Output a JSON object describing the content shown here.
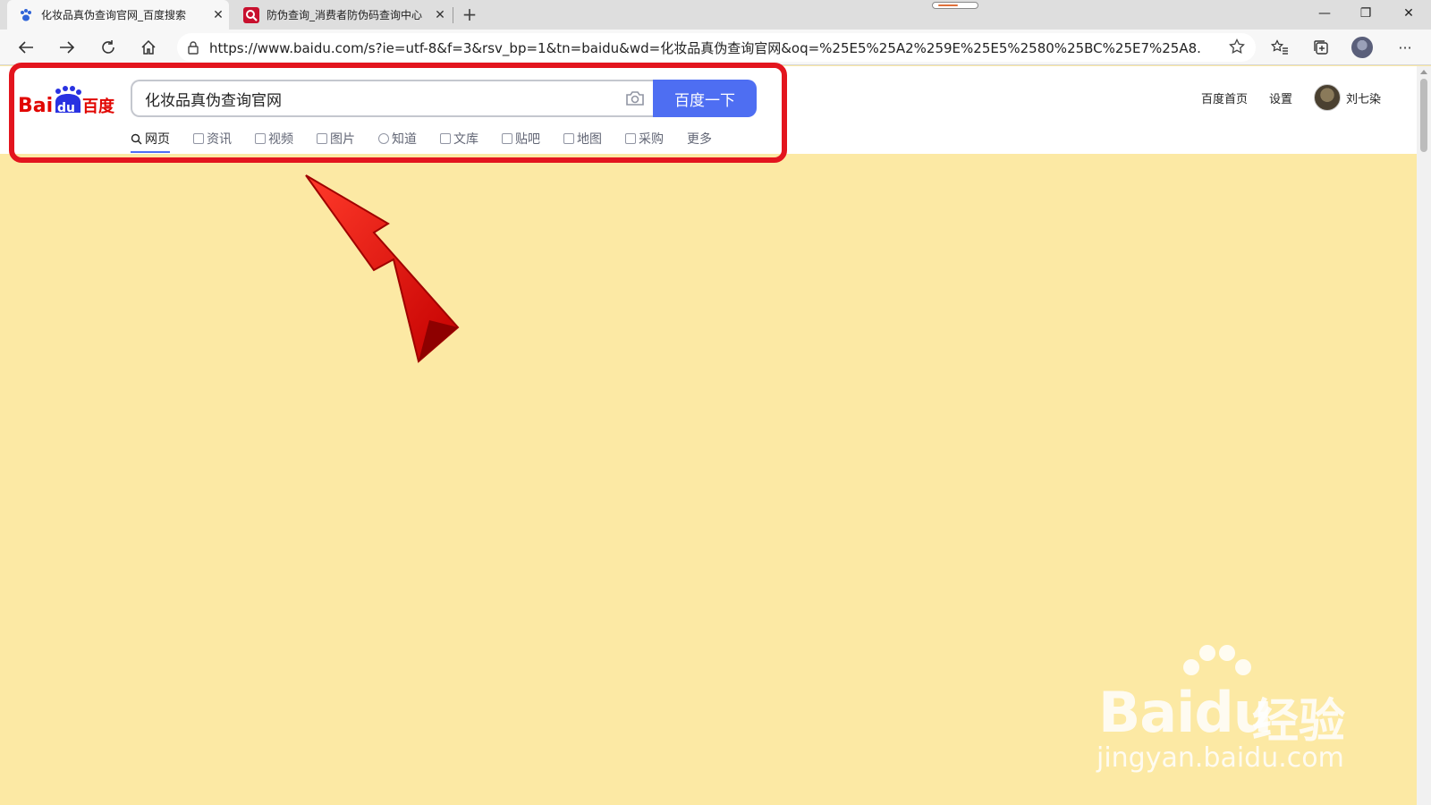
{
  "browser": {
    "tabs": [
      {
        "title": "化妆品真伪查询官网_百度搜索",
        "active": true
      },
      {
        "title": "防伪查询_消费者防伪码查询中心",
        "active": false
      }
    ],
    "new_tab": "+",
    "url": "https://www.baidu.com/s?ie=utf-8&f=3&rsv_bp=1&tn=baidu&wd=化妆品真伪查询官网&oq=%25E5%25A2%259E%25E5%2580%25BC%25E7%25A8...",
    "window_buttons": {
      "minimize": "—",
      "restore": "❐",
      "close": "✕"
    },
    "more": "···"
  },
  "header": {
    "logo_text": "Baidu百度",
    "search_query": "化妆品真伪查询官网",
    "search_button": "百度一下",
    "nav": [
      {
        "label": "网页",
        "icon": "search-icon",
        "active": true
      },
      {
        "label": "资讯",
        "icon": "news-icon",
        "active": false
      },
      {
        "label": "视频",
        "icon": "video-icon",
        "active": false
      },
      {
        "label": "图片",
        "icon": "image-icon",
        "active": false
      },
      {
        "label": "知道",
        "icon": "question-icon",
        "active": false
      },
      {
        "label": "文库",
        "icon": "doc-icon",
        "active": false
      },
      {
        "label": "贴吧",
        "icon": "tieba-icon",
        "active": false
      },
      {
        "label": "地图",
        "icon": "map-icon",
        "active": false
      },
      {
        "label": "采购",
        "icon": "shop-icon",
        "active": false
      },
      {
        "label": "更多",
        "icon": "",
        "active": false
      }
    ],
    "right": {
      "home_link": "百度首页",
      "settings_link": "设置",
      "username": "刘七染"
    }
  },
  "watermark": {
    "brand": "Baidu",
    "brand_cn": "经验",
    "url": "jingyan.baidu.com"
  },
  "colors": {
    "page_background": "#fce9a4",
    "accent_blue": "#4e6ef2",
    "highlight_red": "#e3151e"
  }
}
